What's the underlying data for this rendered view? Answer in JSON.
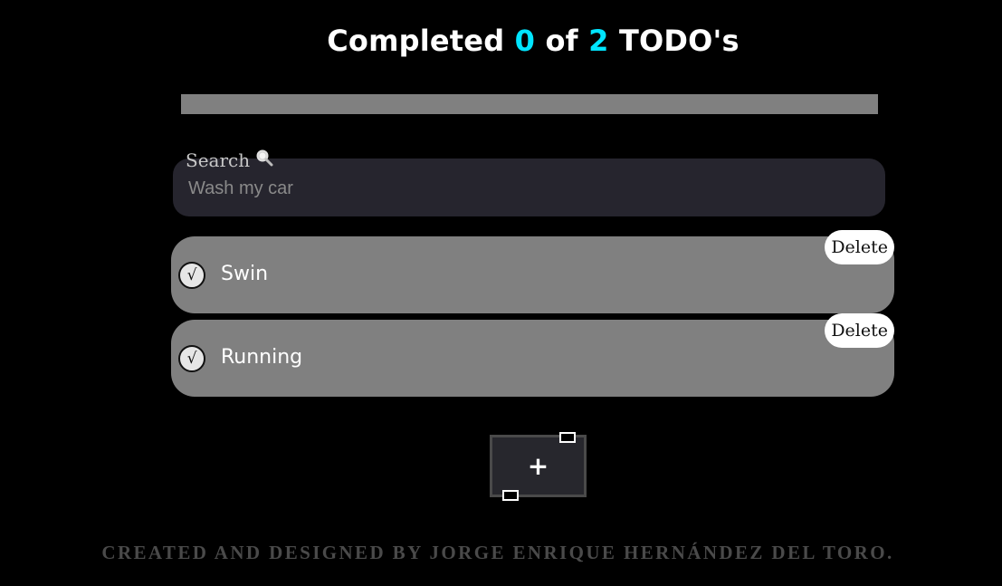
{
  "header": {
    "prefix": "Completed",
    "completed": "0",
    "middle": "of",
    "total": "2",
    "suffix": "TODO's"
  },
  "progress": {
    "fraction": 0.0
  },
  "search": {
    "label": "Search",
    "icon": "magnifier-icon",
    "placeholder": "Wash my car",
    "value": ""
  },
  "todos": [
    {
      "text": "Swin",
      "completed": false,
      "check_glyph": "√",
      "delete_label": "Delete"
    },
    {
      "text": "Running",
      "completed": false,
      "check_glyph": "√",
      "delete_label": "Delete"
    }
  ],
  "add_button": {
    "label": "+"
  },
  "footer": {
    "credit": "CREATED AND DESIGNED BY JORGE ENRIQUE HERNÁNDEZ DEL TORO."
  },
  "colors": {
    "background": "#000000",
    "accent": "#00e5ff",
    "item_background": "#808080",
    "search_background": "#26252e"
  }
}
